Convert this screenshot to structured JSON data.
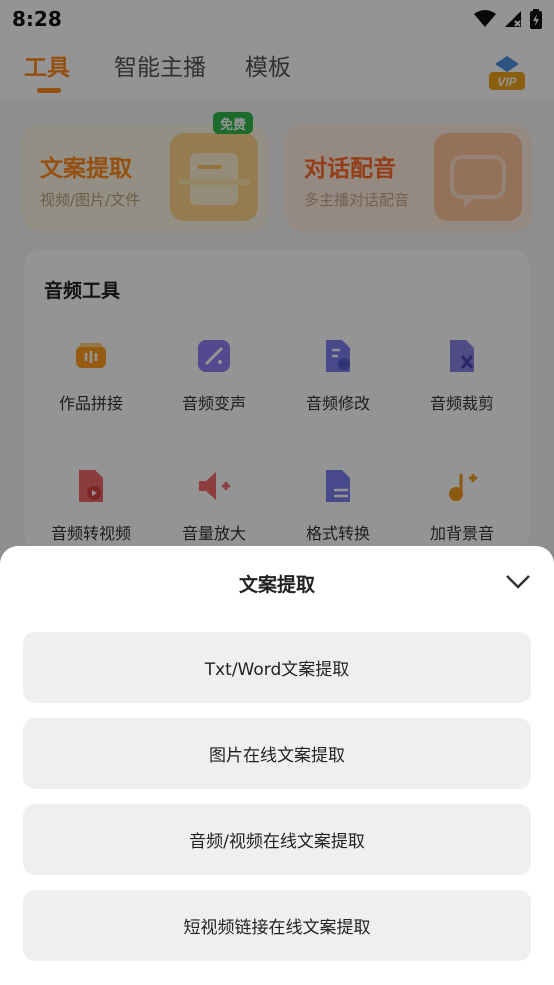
{
  "status_bar": {
    "time": "8:28"
  },
  "tabs": [
    {
      "label": "工具",
      "active": true
    },
    {
      "label": "智能主播",
      "active": false
    },
    {
      "label": "模板",
      "active": false
    }
  ],
  "vip": {
    "label": "VIP"
  },
  "feature_cards": [
    {
      "title": "文案提取",
      "subtitle": "视频/图片/文件",
      "badge": "免费"
    },
    {
      "title": "对话配音",
      "subtitle": "多主播对话配音"
    }
  ],
  "tools": {
    "title": "音频工具",
    "items": [
      {
        "label": "作品拼接",
        "icon": "audio-splice-icon"
      },
      {
        "label": "音频变声",
        "icon": "magic-wand-icon"
      },
      {
        "label": "音频修改",
        "icon": "audio-file-edit-icon"
      },
      {
        "label": "音频裁剪",
        "icon": "audio-file-cut-icon"
      },
      {
        "label": "音频转视频",
        "icon": "audio-to-video-icon"
      },
      {
        "label": "音量放大",
        "icon": "volume-up-icon"
      },
      {
        "label": "格式转换",
        "icon": "format-convert-icon"
      },
      {
        "label": "加背景音",
        "icon": "add-music-icon"
      }
    ]
  },
  "sheet": {
    "title": "文案提取",
    "options": [
      "Txt/Word文案提取",
      "图片在线文案提取",
      "音频/视频在线文案提取",
      "短视频链接在线文案提取"
    ]
  },
  "colors": {
    "accent": "#ff8a1e",
    "card_bg": "#fff6e6",
    "free_badge": "#2db84d",
    "option_bg": "#efefef"
  }
}
